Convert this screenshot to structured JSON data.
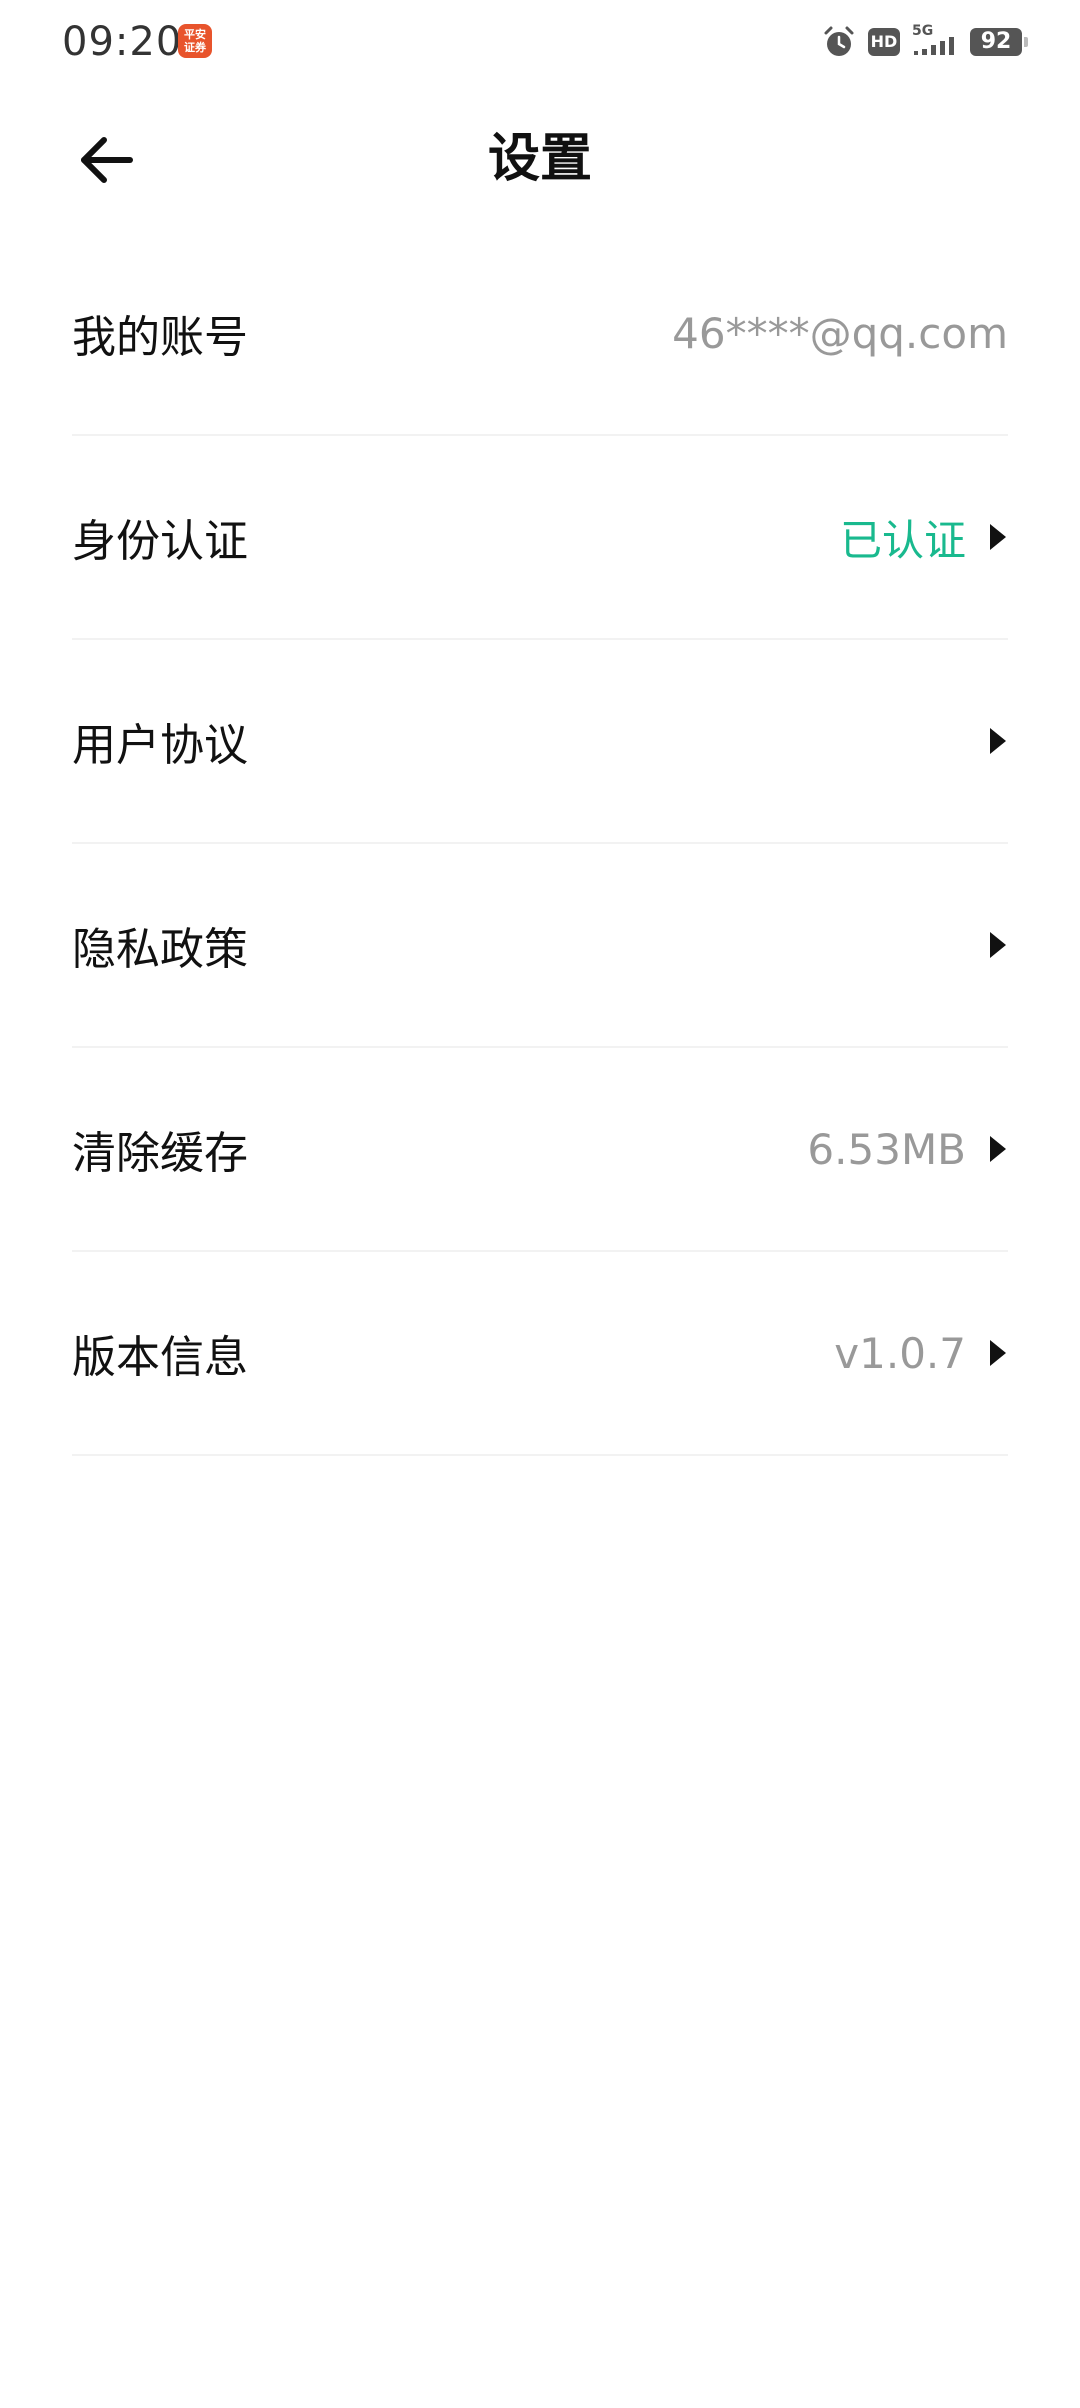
{
  "status_bar": {
    "time": "09:20",
    "app_badge_text": "平安\n证券",
    "hd_label": "HD",
    "network_label": "5G",
    "battery_level": "92",
    "icons": [
      "alarm-icon",
      "hd-icon",
      "signal-5g-icon",
      "battery-icon"
    ]
  },
  "header": {
    "title": "设置",
    "back_icon": "arrow-left-icon"
  },
  "settings": [
    {
      "label": "我的账号",
      "value": "46****@qq.com",
      "chevron": false
    },
    {
      "label": "身份认证",
      "value": "已认证",
      "chevron": true,
      "value_color": "#19b98e"
    },
    {
      "label": "用户协议",
      "value": "",
      "chevron": true
    },
    {
      "label": "隐私政策",
      "value": "",
      "chevron": true
    },
    {
      "label": "清除缓存",
      "value": "6.53MB",
      "chevron": true
    },
    {
      "label": "版本信息",
      "value": "v1.0.7",
      "chevron": true
    }
  ],
  "colors": {
    "background": "#ffffff",
    "text_primary": "#111111",
    "text_secondary": "#999999",
    "accent_verified": "#19b98e",
    "divider": "#f2f2f2",
    "app_badge": "#e8542c"
  }
}
